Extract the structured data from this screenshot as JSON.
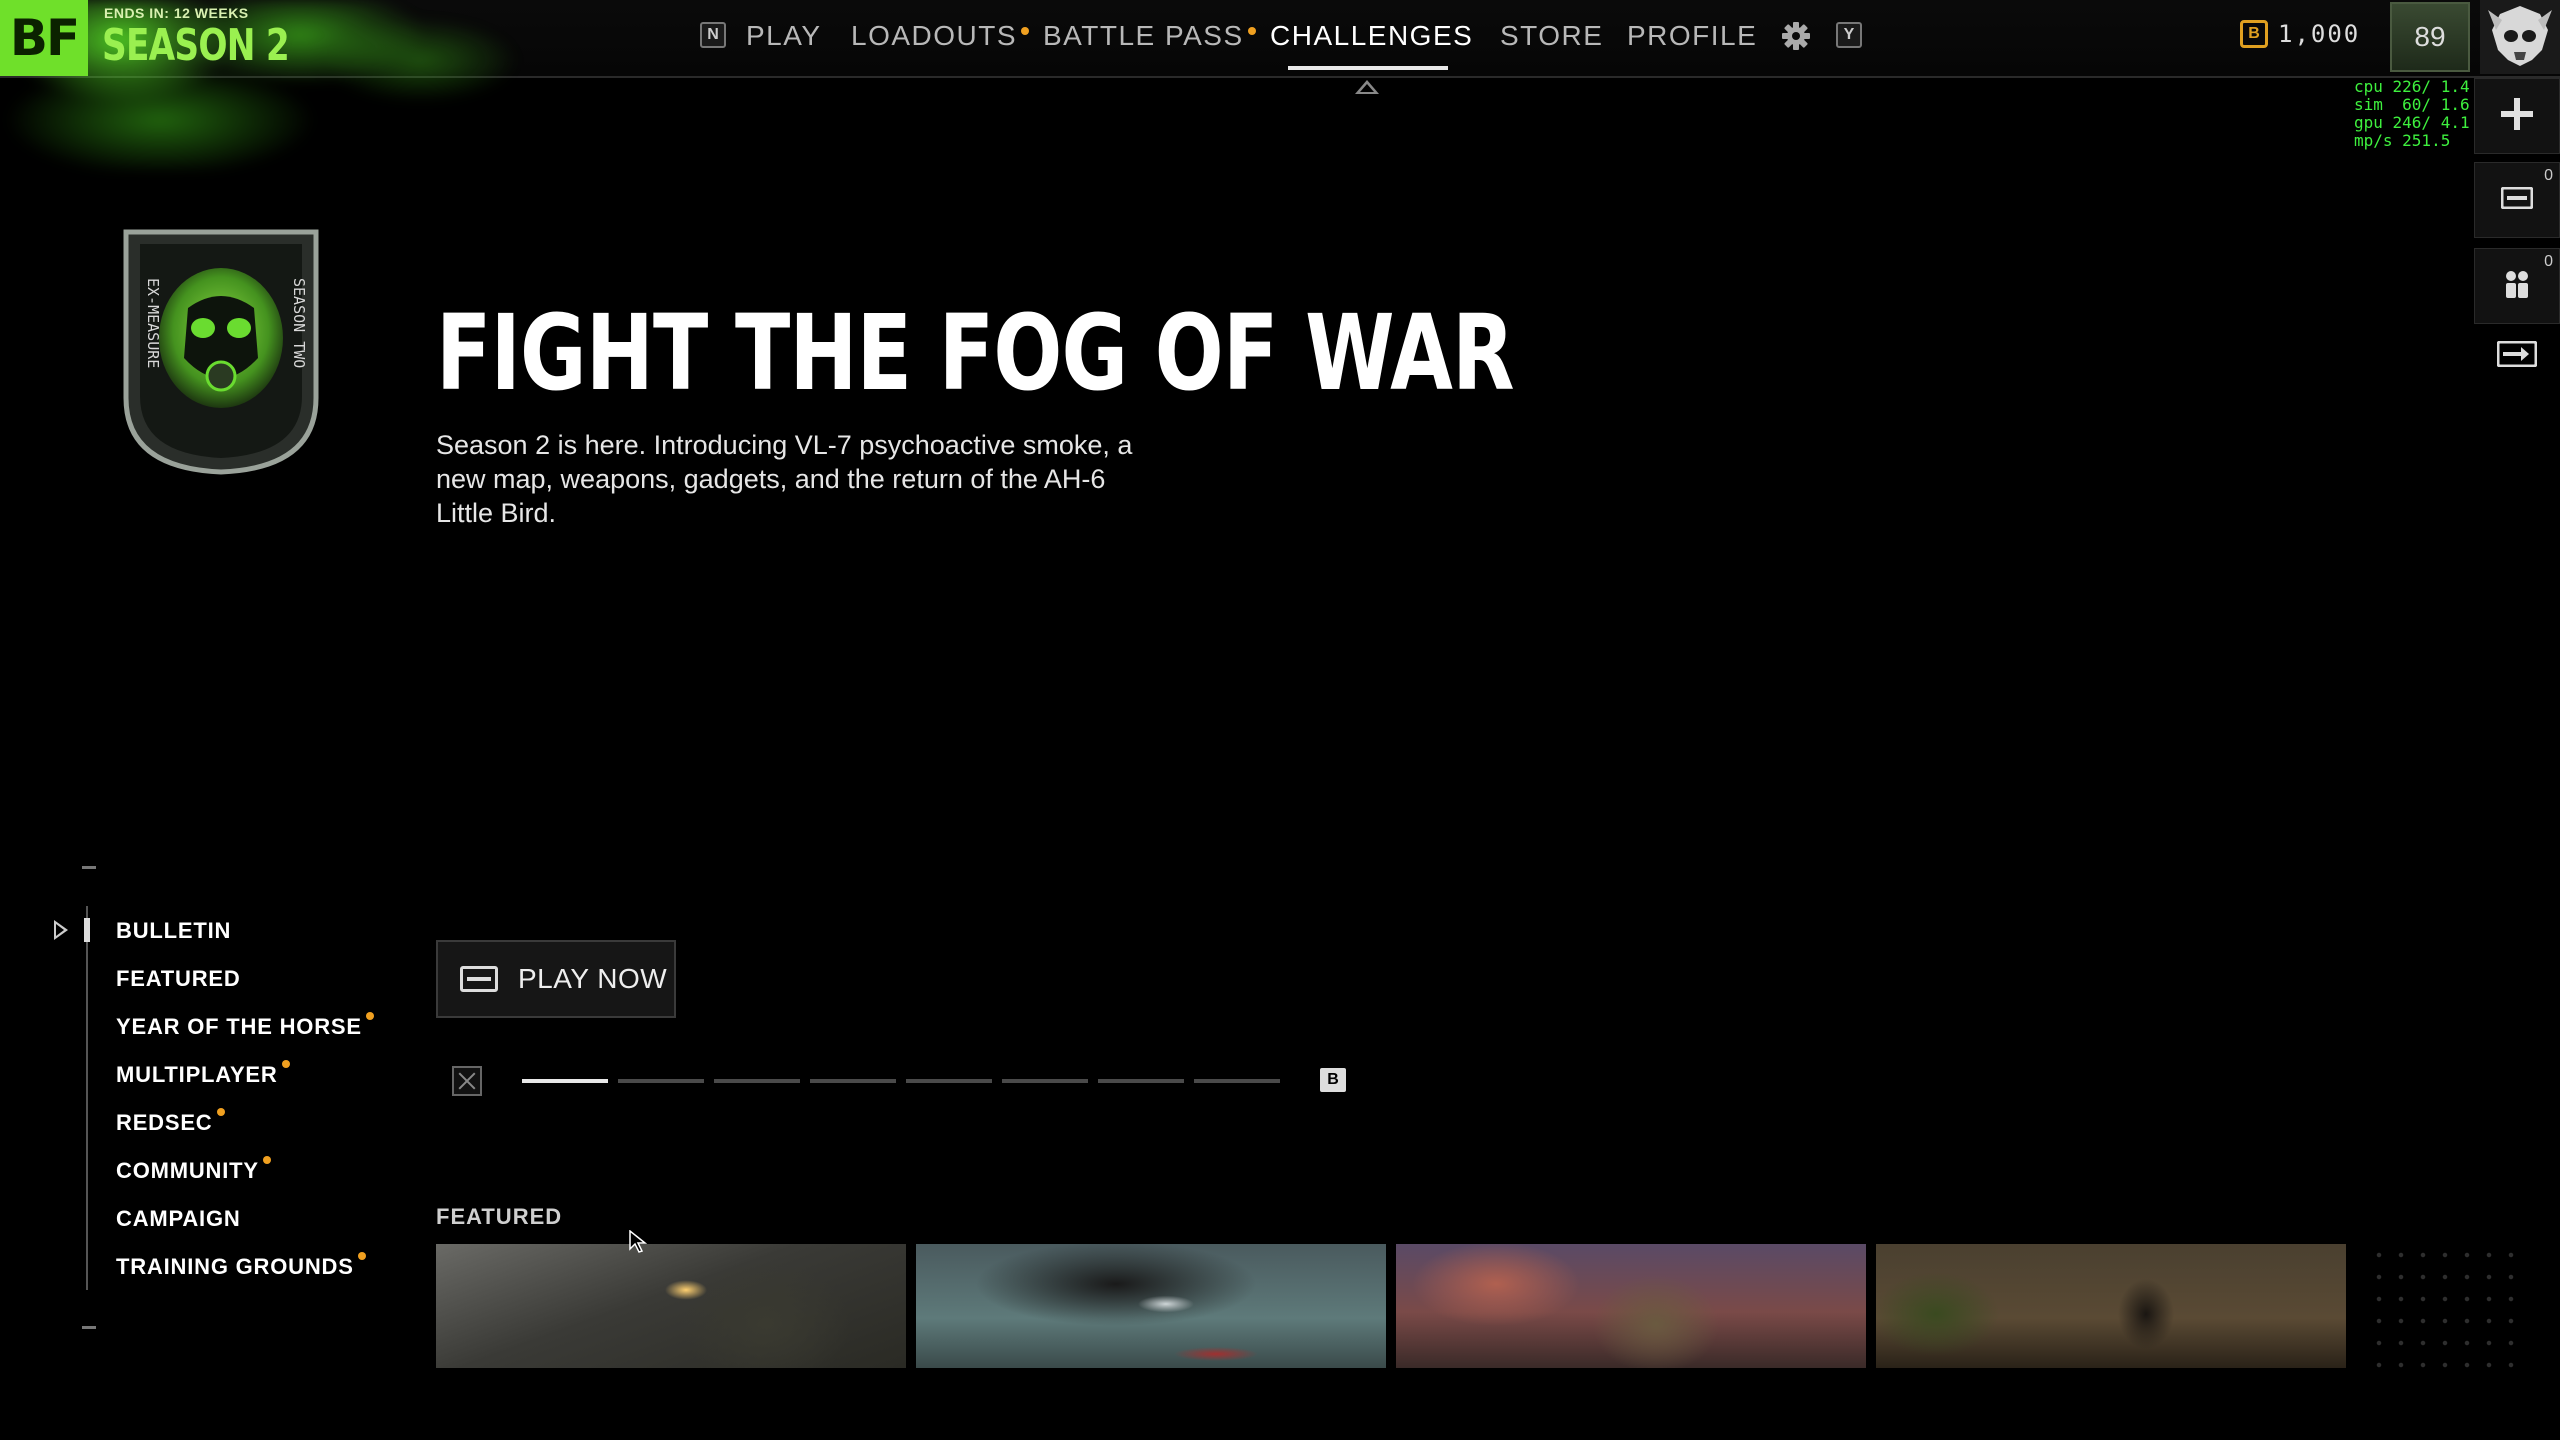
{
  "header": {
    "logo": "BF",
    "season_ends": "ENDS IN: 12 WEEKS",
    "season_title": "SEASON 2",
    "nav_prev_key": "N",
    "nav": [
      {
        "label": "PLAY",
        "active": true,
        "notify": false
      },
      {
        "label": "LOADOUTS",
        "active": false,
        "notify": true
      },
      {
        "label": "BATTLE PASS",
        "active": false,
        "notify": true
      },
      {
        "label": "CHALLENGES",
        "active": false,
        "notify": false
      },
      {
        "label": "STORE",
        "active": false,
        "notify": false
      },
      {
        "label": "PROFILE",
        "active": false,
        "notify": false
      }
    ],
    "settings_icon": "gear-icon",
    "nav_next_key": "Y",
    "currency_icon_letter": "B",
    "currency_amount": "1,000",
    "player_level": "89",
    "avatar_icon": "skull-emblem-icon"
  },
  "perf_overlay": [
    "cpu 226/ 1.4",
    "sim  60/ 1.6",
    "gpu 246/ 4.1",
    "mp/s 251.5"
  ],
  "side_buttons": [
    {
      "icon": "plus-icon",
      "count": ""
    },
    {
      "icon": "mail-icon",
      "count": "0"
    },
    {
      "icon": "party-icon",
      "count": "0"
    },
    {
      "icon": "exit-icon",
      "count": ""
    }
  ],
  "hero": {
    "badge_text_left": "EX-MEASURE",
    "badge_text_right": "SEASON TWO",
    "badge_icon": "gas-mask-badge-icon",
    "title": "FIGHT THE FOG OF WAR",
    "description": "Season 2 is here. Introducing VL-7 psychoactive smoke, a new map, weapons, gadgets, and the return of the AH-6 Little Bird.",
    "cta_label": "PLAY NOW",
    "pager_prev_key": "X",
    "pager_next_key": "B",
    "pager_total": 8,
    "pager_current": 1
  },
  "menu": {
    "items": [
      {
        "label": "BULLETIN",
        "active": true,
        "notify": false
      },
      {
        "label": "FEATURED",
        "active": false,
        "notify": false
      },
      {
        "label": "YEAR OF THE HORSE",
        "active": false,
        "notify": true
      },
      {
        "label": "MULTIPLAYER",
        "active": false,
        "notify": true
      },
      {
        "label": "REDSEC",
        "active": false,
        "notify": true
      },
      {
        "label": "COMMUNITY",
        "active": false,
        "notify": true
      },
      {
        "label": "CAMPAIGN",
        "active": false,
        "notify": false
      },
      {
        "label": "TRAINING GROUNDS",
        "active": false,
        "notify": true
      }
    ]
  },
  "featured": {
    "label": "FEATURED",
    "tiles": [
      "soldier-firing-thumbnail",
      "jet-flyover-thumbnail",
      "helicopter-crew-thumbnail",
      "jungle-soldier-thumbnail"
    ]
  },
  "colors": {
    "accent_green": "#6fe02a",
    "notify_orange": "#f0a020",
    "currency_gold": "#e0a020",
    "perf_green": "#3ef03e"
  }
}
